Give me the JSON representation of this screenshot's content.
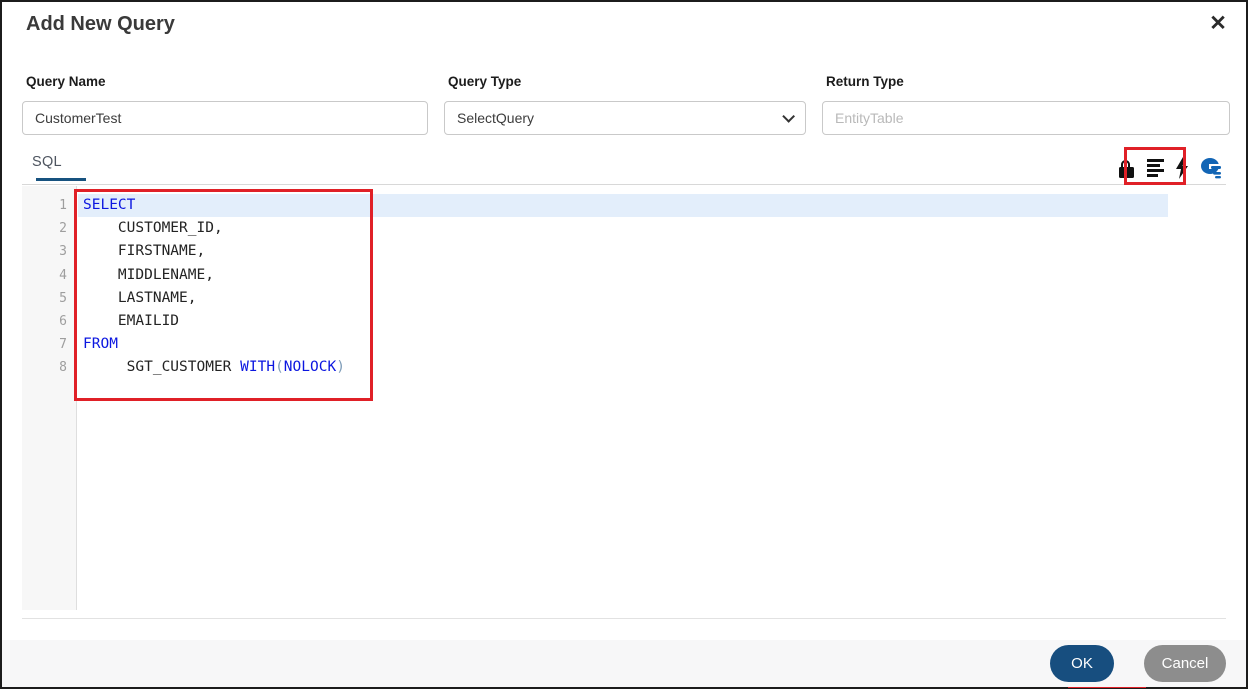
{
  "dialog": {
    "title": "Add New Query",
    "close_icon": "close-icon"
  },
  "form": {
    "query_name": {
      "label": "Query Name",
      "value": "CustomerTest"
    },
    "query_type": {
      "label": "Query Type",
      "selected_value": "SelectQuery",
      "control": "dropdown"
    },
    "return_type": {
      "label": "Return Type",
      "placeholder": "EntityTable"
    }
  },
  "tabs": [
    {
      "label": "SQL",
      "active": true
    }
  ],
  "toolbar": {
    "icons": [
      "lock-icon",
      "format-lines-icon",
      "lightning-icon",
      "database-icon"
    ]
  },
  "editor": {
    "language": "SQL",
    "lines": [
      {
        "number": "1",
        "highlighted": true,
        "tokens": [
          {
            "text": "SELECT",
            "type": "keyword"
          }
        ]
      },
      {
        "number": "2",
        "highlighted": false,
        "tokens": [
          {
            "text": "    CUSTOMER_ID,",
            "type": "plain"
          }
        ]
      },
      {
        "number": "3",
        "highlighted": false,
        "tokens": [
          {
            "text": "    FIRSTNAME,",
            "type": "plain"
          }
        ]
      },
      {
        "number": "4",
        "highlighted": false,
        "tokens": [
          {
            "text": "    MIDDLENAME,",
            "type": "plain"
          }
        ]
      },
      {
        "number": "5",
        "highlighted": false,
        "tokens": [
          {
            "text": "    LASTNAME,",
            "type": "plain"
          }
        ]
      },
      {
        "number": "6",
        "highlighted": false,
        "tokens": [
          {
            "text": "    EMAILID",
            "type": "plain"
          }
        ]
      },
      {
        "number": "7",
        "highlighted": false,
        "tokens": [
          {
            "text": "FROM",
            "type": "keyword"
          }
        ]
      },
      {
        "number": "8",
        "highlighted": false,
        "tokens": [
          {
            "text": "     SGT_CUSTOMER ",
            "type": "plain"
          },
          {
            "text": "WITH",
            "type": "keyword"
          },
          {
            "text": "(",
            "type": "paren"
          },
          {
            "text": "NOLOCK",
            "type": "keyword"
          },
          {
            "text": ")",
            "type": "paren"
          }
        ]
      }
    ]
  },
  "footer": {
    "ok_label": "OK",
    "cancel_label": "Cancel"
  },
  "colors": {
    "primary_button": "#174e7f",
    "accent_tab_underline": "#17527f",
    "annotation_red": "#e02027",
    "keyword_blue": "#0b16e0",
    "current_line_highlight": "#e3eefb",
    "database_icon_blue": "#1265b5"
  }
}
